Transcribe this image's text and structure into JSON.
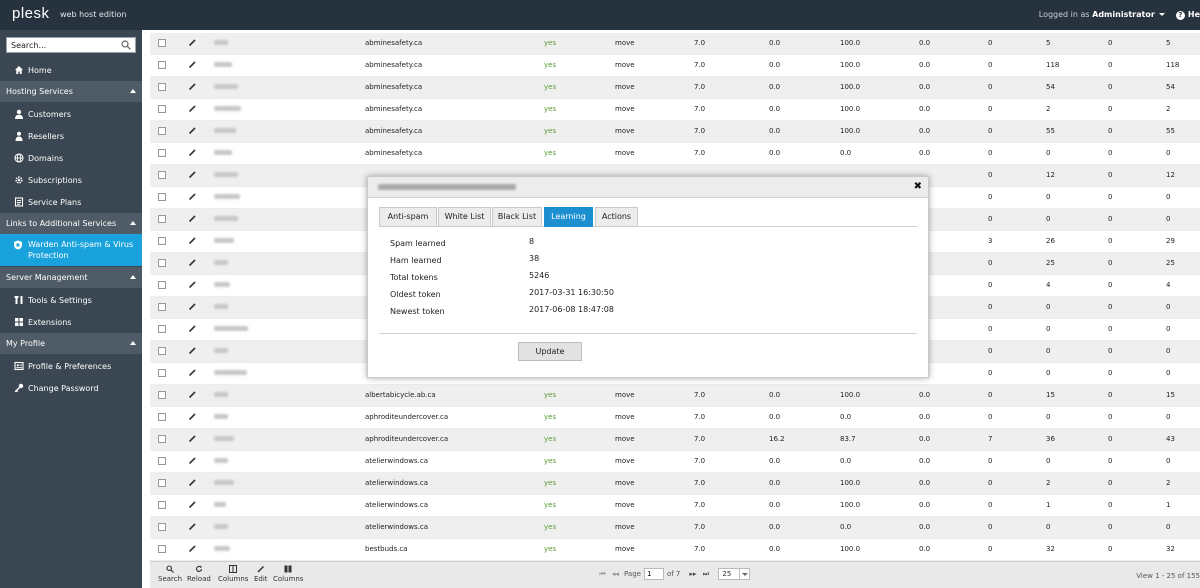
{
  "topbar": {
    "logo": "plesk",
    "edition": "web host edition",
    "logged_in_prefix": "Logged in as",
    "user": "Administrator",
    "help_label": "He"
  },
  "sidebar": {
    "search_placeholder": "Search...",
    "home": "Home",
    "sections": {
      "hosting": "Hosting Services",
      "links": "Links to Additional Services",
      "server": "Server Management",
      "profile": "My Profile"
    },
    "hosting_items": [
      "Customers",
      "Resellers",
      "Domains",
      "Subscriptions",
      "Service Plans"
    ],
    "links_item": "Warden Anti-spam & Virus Protection",
    "server_items": [
      "Tools & Settings",
      "Extensions"
    ],
    "profile_items": [
      "Profile & Preferences",
      "Change Password"
    ]
  },
  "grid": {
    "rows": [
      {
        "domain": "abminesafety.ca",
        "enabled": "yes",
        "action": "move",
        "t1": "7.0",
        "t2": "0.0",
        "t3": "100.0",
        "t4": "0.0",
        "n1": "0",
        "n2": "5",
        "n3": "0",
        "n4": "5"
      },
      {
        "domain": "abminesafety.ca",
        "enabled": "yes",
        "action": "move",
        "t1": "7.0",
        "t2": "0.0",
        "t3": "100.0",
        "t4": "0.0",
        "n1": "0",
        "n2": "118",
        "n3": "0",
        "n4": "118"
      },
      {
        "domain": "abminesafety.ca",
        "enabled": "yes",
        "action": "move",
        "t1": "7.0",
        "t2": "0.0",
        "t3": "100.0",
        "t4": "0.0",
        "n1": "0",
        "n2": "54",
        "n3": "0",
        "n4": "54"
      },
      {
        "domain": "abminesafety.ca",
        "enabled": "yes",
        "action": "move",
        "t1": "7.0",
        "t2": "0.0",
        "t3": "100.0",
        "t4": "0.0",
        "n1": "0",
        "n2": "2",
        "n3": "0",
        "n4": "2"
      },
      {
        "domain": "abminesafety.ca",
        "enabled": "yes",
        "action": "move",
        "t1": "7.0",
        "t2": "0.0",
        "t3": "100.0",
        "t4": "0.0",
        "n1": "0",
        "n2": "55",
        "n3": "0",
        "n4": "55"
      },
      {
        "domain": "abminesafety.ca",
        "enabled": "yes",
        "action": "move",
        "t1": "7.0",
        "t2": "0.0",
        "t3": "0.0",
        "t4": "0.0",
        "n1": "0",
        "n2": "0",
        "n3": "0",
        "n4": "0"
      },
      {
        "domain": "",
        "enabled": "",
        "action": "",
        "t1": "",
        "t2": "",
        "t3": "",
        "t4": "",
        "n1": "0",
        "n2": "12",
        "n3": "0",
        "n4": "12"
      },
      {
        "domain": "",
        "enabled": "",
        "action": "",
        "t1": "",
        "t2": "",
        "t3": "",
        "t4": "",
        "n1": "0",
        "n2": "0",
        "n3": "0",
        "n4": "0"
      },
      {
        "domain": "",
        "enabled": "",
        "action": "",
        "t1": "",
        "t2": "",
        "t3": "",
        "t4": "",
        "n1": "0",
        "n2": "0",
        "n3": "0",
        "n4": "0"
      },
      {
        "domain": "",
        "enabled": "",
        "action": "",
        "t1": "",
        "t2": "",
        "t3": "",
        "t4": "",
        "n1": "3",
        "n2": "26",
        "n3": "0",
        "n4": "29"
      },
      {
        "domain": "",
        "enabled": "",
        "action": "",
        "t1": "",
        "t2": "",
        "t3": "",
        "t4": "",
        "n1": "0",
        "n2": "25",
        "n3": "0",
        "n4": "25"
      },
      {
        "domain": "",
        "enabled": "",
        "action": "",
        "t1": "",
        "t2": "",
        "t3": "",
        "t4": "",
        "n1": "0",
        "n2": "4",
        "n3": "0",
        "n4": "4"
      },
      {
        "domain": "",
        "enabled": "",
        "action": "",
        "t1": "",
        "t2": "",
        "t3": "",
        "t4": "",
        "n1": "0",
        "n2": "0",
        "n3": "0",
        "n4": "0"
      },
      {
        "domain": "",
        "enabled": "",
        "action": "",
        "t1": "",
        "t2": "",
        "t3": "",
        "t4": "",
        "n1": "0",
        "n2": "0",
        "n3": "0",
        "n4": "0"
      },
      {
        "domain": "",
        "enabled": "",
        "action": "",
        "t1": "",
        "t2": "",
        "t3": "",
        "t4": "",
        "n1": "0",
        "n2": "0",
        "n3": "0",
        "n4": "0"
      },
      {
        "domain": "",
        "enabled": "",
        "action": "",
        "t1": "",
        "t2": "",
        "t3": "",
        "t4": "",
        "n1": "0",
        "n2": "0",
        "n3": "0",
        "n4": "0"
      },
      {
        "domain": "albertabicycle.ab.ca",
        "enabled": "yes",
        "action": "move",
        "t1": "7.0",
        "t2": "0.0",
        "t3": "100.0",
        "t4": "0.0",
        "n1": "0",
        "n2": "15",
        "n3": "0",
        "n4": "15"
      },
      {
        "domain": "aphroditeundercover.ca",
        "enabled": "yes",
        "action": "move",
        "t1": "7.0",
        "t2": "0.0",
        "t3": "0.0",
        "t4": "0.0",
        "n1": "0",
        "n2": "0",
        "n3": "0",
        "n4": "0"
      },
      {
        "domain": "aphroditeundercover.ca",
        "enabled": "yes",
        "action": "move",
        "t1": "7.0",
        "t2": "16.2",
        "t3": "83.7",
        "t4": "0.0",
        "n1": "7",
        "n2": "36",
        "n3": "0",
        "n4": "43"
      },
      {
        "domain": "atelierwindows.ca",
        "enabled": "yes",
        "action": "move",
        "t1": "7.0",
        "t2": "0.0",
        "t3": "0.0",
        "t4": "0.0",
        "n1": "0",
        "n2": "0",
        "n3": "0",
        "n4": "0"
      },
      {
        "domain": "atelierwindows.ca",
        "enabled": "yes",
        "action": "move",
        "t1": "7.0",
        "t2": "0.0",
        "t3": "100.0",
        "t4": "0.0",
        "n1": "0",
        "n2": "2",
        "n3": "0",
        "n4": "2"
      },
      {
        "domain": "atelierwindows.ca",
        "enabled": "yes",
        "action": "move",
        "t1": "7.0",
        "t2": "0.0",
        "t3": "100.0",
        "t4": "0.0",
        "n1": "0",
        "n2": "1",
        "n3": "0",
        "n4": "1"
      },
      {
        "domain": "atelierwindows.ca",
        "enabled": "yes",
        "action": "move",
        "t1": "7.0",
        "t2": "0.0",
        "t3": "0.0",
        "t4": "0.0",
        "n1": "0",
        "n2": "0",
        "n3": "0",
        "n4": "0"
      },
      {
        "domain": "bestbuds.ca",
        "enabled": "yes",
        "action": "move",
        "t1": "7.0",
        "t2": "0.0",
        "t3": "100.0",
        "t4": "0.0",
        "n1": "0",
        "n2": "32",
        "n3": "0",
        "n4": "32"
      }
    ]
  },
  "toolbar": {
    "search": "Search",
    "reload": "Reload",
    "columns1": "Columns",
    "edit": "Edit",
    "columns2": "Columns",
    "page_label": "Page",
    "page_value": "1",
    "page_of": "of 7",
    "page_size": "25",
    "view_info": "View 1 - 25 of 155"
  },
  "modal": {
    "tabs": [
      "Anti-spam",
      "White List",
      "Black List",
      "Learning",
      "Actions"
    ],
    "active_tab": "Learning",
    "fields": [
      {
        "label": "Spam learned",
        "value": "8"
      },
      {
        "label": "Ham learned",
        "value": "38"
      },
      {
        "label": "Total tokens",
        "value": "5246"
      },
      {
        "label": "Oldest token",
        "value": "2017-03-31 16:30:50"
      },
      {
        "label": "Newest token",
        "value": "2017-06-08 18:47:08"
      }
    ],
    "update_button": "Update",
    "close_icon": "close-icon"
  },
  "colors": {
    "topbar": "#26323d",
    "sidebar": "#3a4651",
    "sidebar_active": "#1aa2dd",
    "tab_active": "#1b8fcf",
    "yes_green": "#5b9a3a"
  }
}
